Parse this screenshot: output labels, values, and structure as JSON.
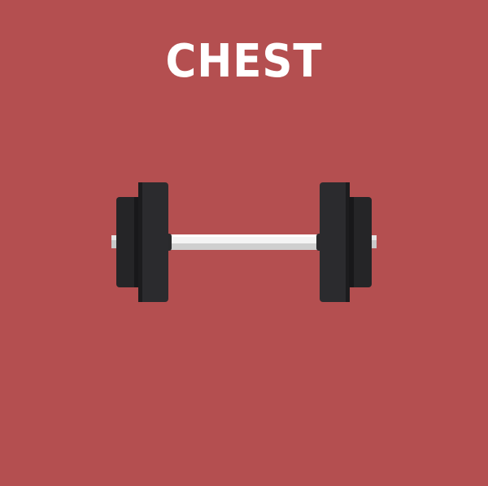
{
  "card": {
    "title": "CHEST",
    "background_color": "#b44f50",
    "icon": "dumbbell-icon"
  }
}
